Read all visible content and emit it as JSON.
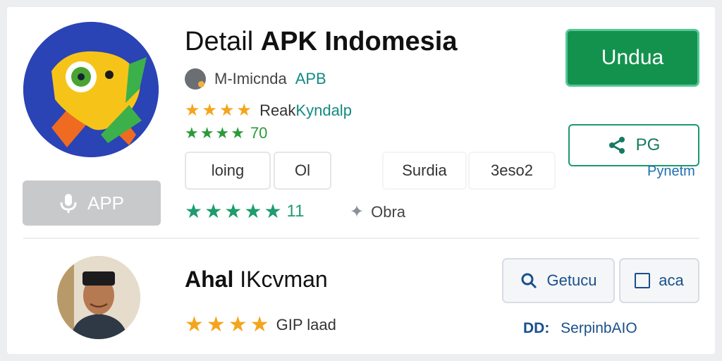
{
  "app": {
    "title_prefix": "Detail",
    "title_main": "APK Indomesia",
    "developer": "M-Imicnda",
    "developer_tag": "APB",
    "app_button_label": "APP",
    "rating_text_a": "Reak",
    "rating_text_b": "Kyndalp",
    "rating_stars": 4,
    "score_stars": 4,
    "score_value": "70",
    "chips": [
      "loing",
      "Ol",
      "Surdia",
      "3eso2"
    ],
    "reviews_stars": 5,
    "reviews_count": "11",
    "obra_label": "Obra"
  },
  "actions": {
    "download_label": "Undua",
    "share_label": "PG",
    "share_link": "Pynetm"
  },
  "author": {
    "name_bold": "Ahal",
    "name_rest": "IKcvman",
    "stars": 4,
    "rating_label": "GIP laad",
    "search_label": "Getucu",
    "box_label": "aca",
    "link_prefix": "DD:",
    "link_text": "SerpinbAIO"
  },
  "colors": {
    "primary_green": "#13924e",
    "star_orange": "#f4a51c",
    "teal": "#128a82",
    "link_blue": "#1a4f8c"
  },
  "icons": [
    "mascot-app-icon",
    "mic-icon",
    "share-icon",
    "search-icon",
    "square-icon",
    "developer-logo-icon",
    "star-icon"
  ]
}
